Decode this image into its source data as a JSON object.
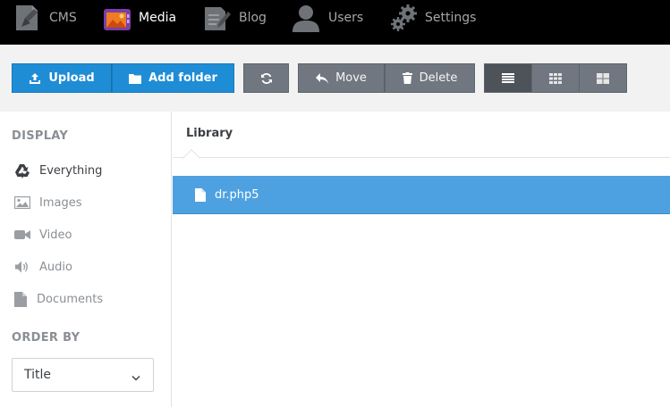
{
  "nav": {
    "items": [
      {
        "label": "CMS",
        "icon": "cms-doc-icon"
      },
      {
        "label": "Media",
        "icon": "media-image-icon",
        "active": true
      },
      {
        "label": "Blog",
        "icon": "blog-pencil-icon"
      },
      {
        "label": "Users",
        "icon": "user-icon"
      },
      {
        "label": "Settings",
        "icon": "gears-icon"
      }
    ]
  },
  "toolbar": {
    "upload_label": "Upload",
    "add_folder_label": "Add folder",
    "move_label": "Move",
    "delete_label": "Delete",
    "refresh_icon": "refresh-icon",
    "views": [
      "list-view",
      "grid-view",
      "tiles-view"
    ],
    "active_view": "list-view"
  },
  "sidebar": {
    "display_title": "DISPLAY",
    "items": [
      {
        "label": "Everything",
        "icon": "recycle-icon",
        "active": true
      },
      {
        "label": "Images",
        "icon": "image-icon"
      },
      {
        "label": "Video",
        "icon": "video-camera-icon"
      },
      {
        "label": "Audio",
        "icon": "speaker-icon"
      },
      {
        "label": "Documents",
        "icon": "document-icon"
      }
    ],
    "order_title": "ORDER BY",
    "order_value": "Title"
  },
  "main": {
    "breadcrumb": "Library",
    "files": [
      {
        "name": "dr.php5",
        "selected": true
      }
    ]
  },
  "colors": {
    "nav_bg": "#000000",
    "primary_blue": "#1f8dd6",
    "selected_row": "#4ea1e0",
    "gray_button": "#707780"
  }
}
